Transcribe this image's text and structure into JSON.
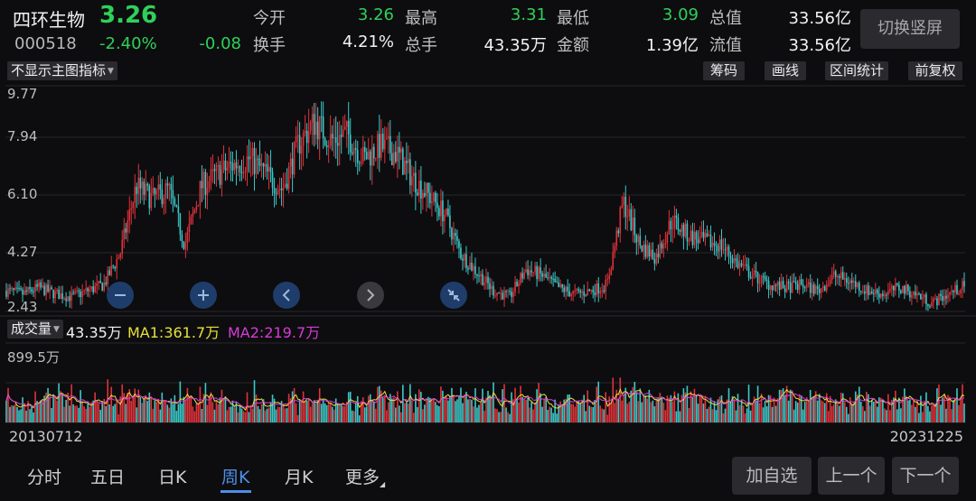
{
  "stock": {
    "name": "四环生物",
    "price": "3.26",
    "code": "000518",
    "change_pct": "-2.40%",
    "change": "-0.08"
  },
  "quote": {
    "row1": [
      {
        "label": "今开",
        "value": "3.26"
      },
      {
        "label": "最高",
        "value": "3.31"
      },
      {
        "label": "最低",
        "value": "3.09"
      },
      {
        "label": "总值",
        "value": "33.56亿"
      }
    ],
    "row2": [
      {
        "label": "换手",
        "value": "4.21%"
      },
      {
        "label": "总手",
        "value": "43.35万"
      },
      {
        "label": "金额",
        "value": "1.39亿"
      },
      {
        "label": "流值",
        "value": "33.56亿"
      }
    ]
  },
  "switch_button": "切换竖屏",
  "indicator_select": "不显示主图指标",
  "tools": [
    "筹码",
    "画线",
    "区间统计",
    "前复权"
  ],
  "y_axis": [
    "9.77",
    "7.94",
    "6.10",
    "4.27",
    "2.43"
  ],
  "volume": {
    "select": "成交量",
    "current": "43.35万",
    "ma1": "MA1:361.7万",
    "ma2": "MA2:219.7万",
    "max_label": "899.5万"
  },
  "dates": {
    "start": "20130712",
    "end": "20231225"
  },
  "period_tabs": [
    "分时",
    "五日",
    "日K",
    "周K",
    "月K",
    "更多"
  ],
  "active_tab": "周K",
  "bottom_buttons": [
    "加自选",
    "上一个",
    "下一个"
  ],
  "colors": {
    "up": "#e0323a",
    "down": "#3cc8c8",
    "ma1": "#e8e03a",
    "ma2": "#d83ad8",
    "accent": "#4e8fe6",
    "price_green": "#2fd05a"
  },
  "icons": [
    "zoom-out-icon",
    "zoom-in-icon",
    "pan-left-icon",
    "pan-right-icon",
    "collapse-icon"
  ],
  "chart_data": {
    "type": "candlestick",
    "x_range": [
      "20130712",
      "20231225"
    ],
    "ylim": [
      2.43,
      9.77
    ],
    "price_path": [
      3.1,
      3.0,
      3.2,
      3.0,
      2.9,
      3.1,
      3.3,
      4.3,
      6.5,
      6.1,
      6.4,
      4.6,
      6.5,
      6.9,
      7.2,
      7.4,
      6.9,
      6.4,
      7.9,
      8.6,
      8.0,
      8.2,
      7.4,
      7.8,
      7.6,
      6.8,
      6.2,
      5.6,
      4.3,
      3.7,
      3.1,
      2.9,
      3.8,
      3.6,
      3.2,
      3.0,
      3.1,
      3.3,
      6.0,
      4.6,
      4.2,
      5.4,
      4.9,
      4.7,
      4.6,
      4.0,
      3.6,
      3.3,
      3.2,
      3.3,
      3.1,
      3.6,
      3.4,
      3.1,
      3.0,
      3.2,
      3.0,
      2.7,
      3.0,
      3.26
    ],
    "volume_max": "899.5万"
  }
}
